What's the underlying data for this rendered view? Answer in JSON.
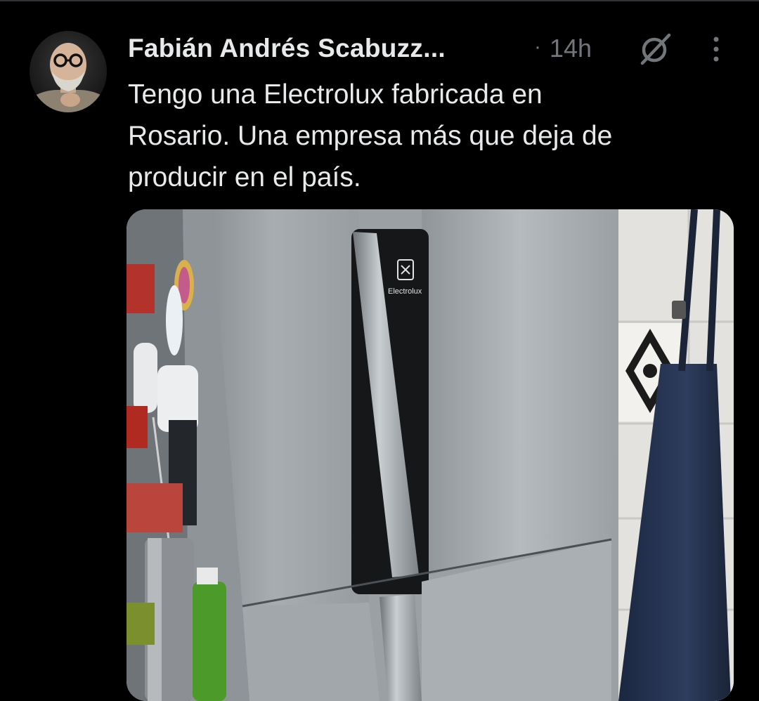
{
  "post": {
    "author_name": "Fabián Andrés Scabuzz...",
    "separator": "·",
    "timestamp": "14h",
    "text": "Tengo una Electrolux fabricada en\nRosario. Una empresa más que deja de\nproducir en el país.",
    "avatar_icon": "profile-photo",
    "grok_icon": "grok-icon",
    "more_icon": "more-vertical-icon"
  },
  "media": {
    "description_icon": "photo",
    "brand_text": "Electrolux"
  },
  "colors": {
    "background": "#000000",
    "text_primary": "#e7e9ea",
    "text_secondary": "#71767b"
  }
}
